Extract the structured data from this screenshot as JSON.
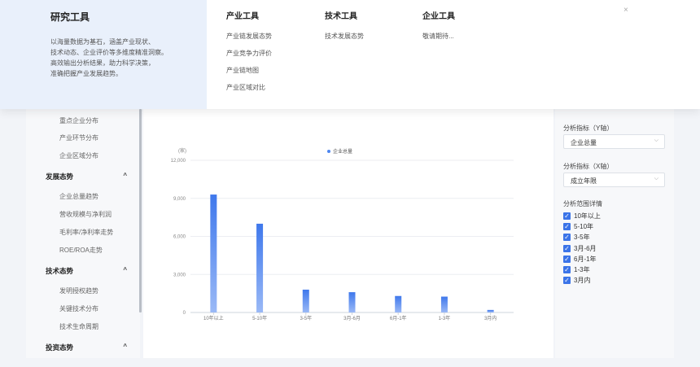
{
  "menu": {
    "title": "研究工具",
    "desc": [
      "以海量数据为基石，涵盖产业现状、",
      "技术动态、企业评价等多维度精准洞察。",
      "高效输出分析结果，助力科学决策，",
      "准确把握产业发展趋势。"
    ],
    "columns": [
      {
        "header": "产业工具",
        "items": [
          "产业链发展态势",
          "产业竞争力评价",
          "产业链地图",
          "产业区域对比"
        ]
      },
      {
        "header": "技术工具",
        "items": [
          "技术发展态势"
        ]
      },
      {
        "header": "企业工具",
        "items": [
          "敬请期待..."
        ]
      }
    ],
    "close": "×"
  },
  "sidebar": {
    "items_top": [
      "重点企业分布",
      "产业环节分布",
      "企业区域分布"
    ],
    "groups": [
      {
        "title": "发展态势",
        "caret": "^",
        "items": [
          "企业总量趋势",
          "营收规模与净利润",
          "毛利率/净利率走势",
          "ROE/ROA走势"
        ]
      },
      {
        "title": "技术态势",
        "caret": "^",
        "items": [
          "发明授权趋势",
          "关键技术分布",
          "技术生命周期"
        ]
      },
      {
        "title": "投资态势",
        "caret": "^",
        "items": []
      }
    ]
  },
  "config": {
    "y_label": "分析指标（Y轴）",
    "y_value": "企业总量",
    "x_label": "分析指标（X轴）",
    "x_value": "成立年限",
    "range_label": "分析范围详情",
    "checks": [
      "10年以上",
      "5-10年",
      "3-5年",
      "3月-6月",
      "6月-1年",
      "1-3年",
      "3月内"
    ],
    "check_mark": "✓",
    "chev": "⌵"
  },
  "chart_data": {
    "type": "bar",
    "unit": "(家)",
    "legend": "企业总量",
    "categories": [
      "10年以上",
      "5-10年",
      "3-5年",
      "3月-6月",
      "6月-1年",
      "1-3年",
      "3月内"
    ],
    "values": [
      9300,
      7000,
      1800,
      1600,
      1300,
      1250,
      200
    ],
    "yticks": [
      "0",
      "3,000",
      "6,000",
      "9,000",
      "12,000"
    ],
    "ylim": [
      0,
      12000
    ],
    "color": "#4e86f0"
  }
}
